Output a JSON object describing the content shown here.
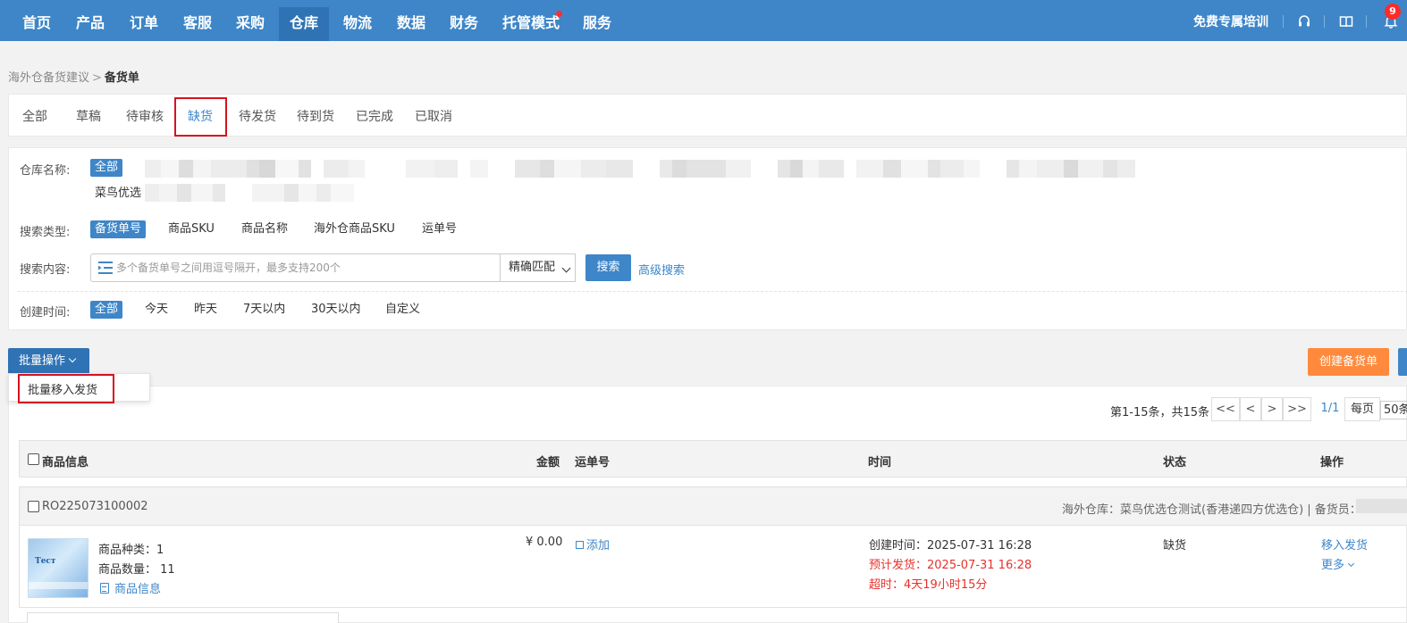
{
  "nav": {
    "items": [
      "首页",
      "产品",
      "订单",
      "客服",
      "采购",
      "仓库",
      "物流",
      "数据",
      "财务",
      "托管模式",
      "服务"
    ],
    "active_index": 5,
    "training_link": "免费专属培训",
    "notification_count": "9",
    "icons": [
      "headset-icon",
      "book-icon",
      "bell-icon"
    ]
  },
  "breadcrumb": {
    "parent": "海外仓备货建议",
    "separator": ">",
    "current": "备货单"
  },
  "tabs": {
    "items": [
      "全部",
      "草稿",
      "待审核",
      "缺货",
      "待发货",
      "待到货",
      "已完成",
      "已取消"
    ],
    "active_index": 3
  },
  "filters": {
    "warehouse_label": "仓库名称:",
    "warehouse_all": "全部",
    "warehouse_partial": "菜鸟优选",
    "search_type_label": "搜索类型:",
    "search_types": [
      "备货单号",
      "商品SKU",
      "商品名称",
      "海外仓商品SKU",
      "运单号"
    ],
    "search_content_label": "搜索内容:",
    "search_placeholder": "多个备货单号之间用逗号隔开，最多支持200个",
    "match_mode": "精确匹配",
    "search_button": "搜索",
    "advanced_search": "高级搜索",
    "created_time_label": "创建时间:",
    "time_options": [
      "全部",
      "今天",
      "昨天",
      "7天以内",
      "30天以内",
      "自定义"
    ]
  },
  "toolbar": {
    "batch_button": "批量操作",
    "batch_menu_item": "批量移入发货",
    "create_button": "创建备货单"
  },
  "pagination": {
    "summary": "第1-15条，共15条",
    "first": "<<",
    "prev": "<",
    "next": ">",
    "last": ">>",
    "current": "1/1",
    "per_page_label": "每页",
    "per_page_value": "50条"
  },
  "table": {
    "headers": {
      "product": "商品信息",
      "amount": "金额",
      "waybill": "运单号",
      "time": "时间",
      "status": "状态",
      "actions": "操作"
    }
  },
  "order": {
    "number": "RO225073100002",
    "warehouse_info": "海外仓库：菜鸟优选仓测试(香港递四方优选仓) | 备货员：",
    "thumb_text": "Тест",
    "kinds": "商品种类：1",
    "quantity": "商品数量： 11",
    "product_info_link": "商品信息",
    "amount": "¥ 0.00",
    "add_waybill": "添加",
    "created_time": "创建时间：2025-07-31 16:28",
    "expected_ship": "预计发货：2025-07-31 16:28",
    "overtime_label": "超时：",
    "overtime_value": "4天19小时15分",
    "status": "缺货",
    "move_to_ship": "移入发货",
    "more": "更多"
  },
  "colors": {
    "nav_bg": "#3e86c8",
    "accent": "#3e86c8",
    "orange": "#ff8a3d",
    "highlight_red": "#d6121f",
    "text_red": "#e8302a"
  }
}
